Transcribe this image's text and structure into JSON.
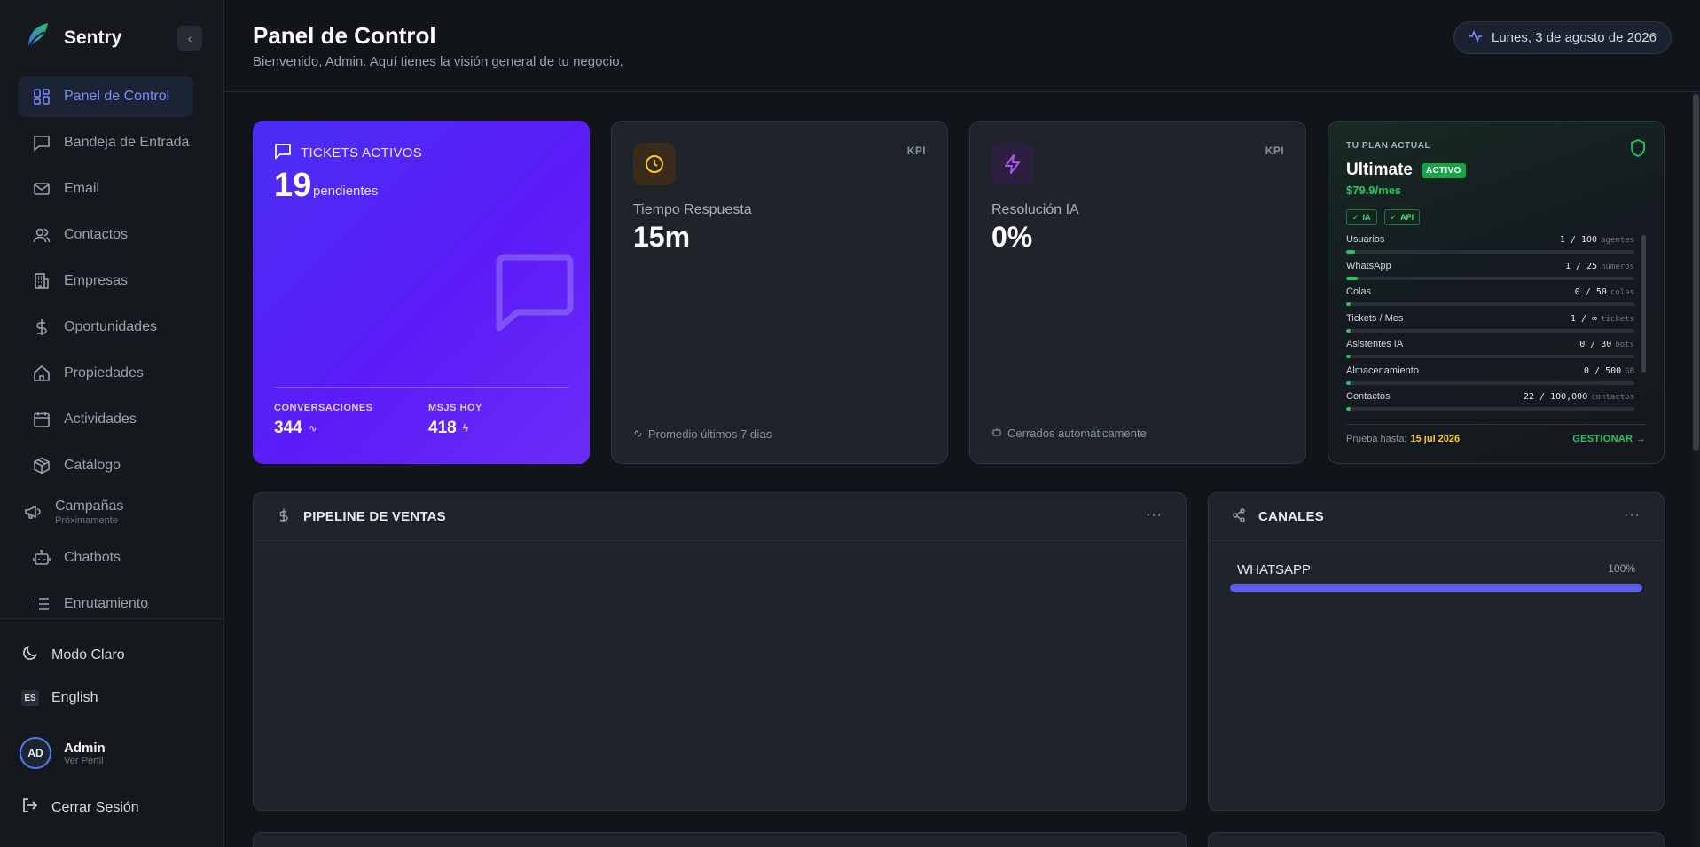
{
  "app": {
    "name": "Sentry"
  },
  "sidebar": {
    "items": [
      {
        "label": "Panel de Control"
      },
      {
        "label": "Bandeja de Entrada"
      },
      {
        "label": "Email"
      },
      {
        "label": "Contactos"
      },
      {
        "label": "Empresas"
      },
      {
        "label": "Oportunidades"
      },
      {
        "label": "Propiedades"
      },
      {
        "label": "Actividades"
      },
      {
        "label": "Catálogo"
      },
      {
        "label": "Campañas",
        "sub": "Próximamente"
      },
      {
        "label": "Chatbots"
      },
      {
        "label": "Enrutamiento"
      }
    ],
    "theme_toggle": "Modo Claro",
    "language_code": "ES",
    "language_label": "English",
    "user": {
      "initials": "AD",
      "name": "Admin",
      "sub": "Ver Perfil"
    },
    "logout": "Cerrar Sesión"
  },
  "header": {
    "title": "Panel de Control",
    "subtitle": "Bienvenido, Admin. Aquí tienes la visión general de tu negocio.",
    "date": "Lunes, 3 de agosto de 2026"
  },
  "tickets": {
    "label": "TICKETS ACTIVOS",
    "value": "19",
    "sub": "pendientes",
    "stats": [
      {
        "label": "CONVERSACIONES",
        "value": "344"
      },
      {
        "label": "MSJS HOY",
        "value": "418"
      }
    ]
  },
  "kpis": [
    {
      "badge": "KPI",
      "label": "Tiempo Respuesta",
      "value": "15m",
      "footer": "Promedio últimos 7 días"
    },
    {
      "badge": "KPI",
      "label": "Resolución IA",
      "value": "0%",
      "footer": "Cerrados automáticamente"
    }
  ],
  "plan": {
    "kicker": "TU PLAN ACTUAL",
    "name": "Ultimate",
    "status": "ACTIVO",
    "price": "$79.9/mes",
    "tags": [
      "IA",
      "API"
    ],
    "usage": [
      {
        "label": "Usuarios",
        "value": "1 / 100",
        "unit": "agentes",
        "fraction": 0.03
      },
      {
        "label": "WhatsApp",
        "value": "1 / 25",
        "unit": "números",
        "fraction": 0.04
      },
      {
        "label": "Colas",
        "value": "0 / 50",
        "unit": "colas",
        "fraction": 0.015
      },
      {
        "label": "Tickets / Mes",
        "value": "1 / ∞",
        "unit": "tickets",
        "fraction": 0.015
      },
      {
        "label": "Asistentes IA",
        "value": "0 / 30",
        "unit": "bots",
        "fraction": 0.015
      },
      {
        "label": "Almacenamiento",
        "value": "0 / 500",
        "unit": "GB",
        "fraction": 0.015
      },
      {
        "label": "Contactos",
        "value": "22 / 100,000",
        "unit": "contactos",
        "fraction": 0.015
      }
    ],
    "trial_label": "Prueba hasta:",
    "trial_date": "15 jul 2026",
    "manage": "GESTIONAR →"
  },
  "pipeline": {
    "title": "PIPELINE DE VENTAS",
    "menu": "···"
  },
  "channels": {
    "title": "CANALES",
    "menu": "···",
    "items": [
      {
        "name": "WHATSAPP",
        "percent": "100%",
        "fraction": 1.0
      }
    ]
  },
  "colors": {
    "accent": "#5b5cf0",
    "success": "#22c55e",
    "warning": "#facc15",
    "tickets_card": "#4a2ff5"
  }
}
